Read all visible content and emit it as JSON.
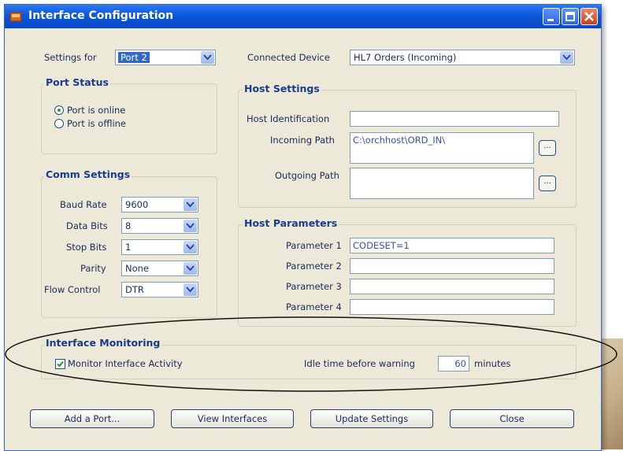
{
  "window": {
    "title": "Interface Configuration"
  },
  "settings_for": {
    "label": "Settings for",
    "value": "Port 2"
  },
  "connected_device": {
    "label": "Connected Device",
    "value": "HL7 Orders (Incoming)"
  },
  "port_status": {
    "title": "Port Status",
    "online_label": "Port is online",
    "offline_label": "Port is offline",
    "selected": "online"
  },
  "comm_settings": {
    "title": "Comm Settings",
    "baud_rate": {
      "label": "Baud Rate",
      "value": "9600"
    },
    "data_bits": {
      "label": "Data Bits",
      "value": "8"
    },
    "stop_bits": {
      "label": "Stop Bits",
      "value": "1"
    },
    "parity": {
      "label": "Parity",
      "value": "None"
    },
    "flow_control": {
      "label": "Flow Control",
      "value": "DTR"
    }
  },
  "host_settings": {
    "title": "Host Settings",
    "host_identification": {
      "label": "Host Identification",
      "value": ""
    },
    "incoming_path": {
      "label": "Incoming Path",
      "value": "C:\\orchhost\\ORD_IN\\"
    },
    "outgoing_path": {
      "label": "Outgoing Path",
      "value": ""
    },
    "browse_label": "..."
  },
  "host_parameters": {
    "title": "Host Parameters",
    "items": [
      {
        "label": "Parameter 1",
        "value": "CODESET=1"
      },
      {
        "label": "Parameter 2",
        "value": ""
      },
      {
        "label": "Parameter 3",
        "value": ""
      },
      {
        "label": "Parameter 4",
        "value": ""
      }
    ]
  },
  "interface_monitoring": {
    "title": "Interface Monitoring",
    "monitor_label": "Monitor Interface Activity",
    "monitor_checked": true,
    "idle_label": "Idle time before warning",
    "idle_value": "60",
    "idle_unit": "minutes"
  },
  "buttons": {
    "add_port": "Add a Port...",
    "view_interfaces": "View Interfaces",
    "update_settings": "Update Settings",
    "close": "Close"
  },
  "colors": {
    "title_bar": "#0a54d8",
    "window_bg": "#ece9d8",
    "highlight": "#316ac5",
    "group_title": "#1b3b8c"
  }
}
